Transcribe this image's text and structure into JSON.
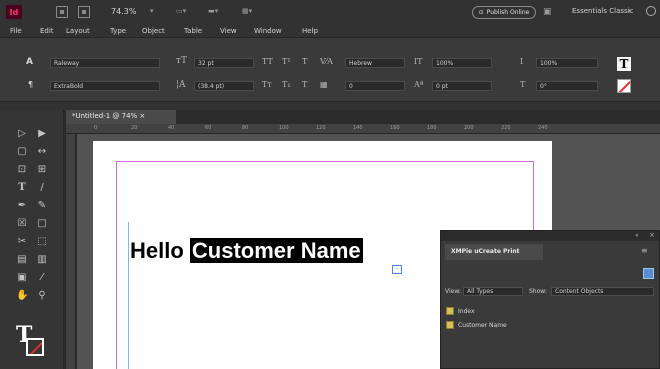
{
  "appbar": {
    "logo": "Id",
    "zoom": "74.3%",
    "publish_label": "Publish Online",
    "workspace": "Essentials Classic"
  },
  "menubar": {
    "items": [
      "File",
      "Edit",
      "Layout",
      "Type",
      "Object",
      "Table",
      "View",
      "Window",
      "Help"
    ]
  },
  "control": {
    "font_family": "Raleway",
    "font_style": "ExtraBold",
    "font_size": "32 pt",
    "leading": "(38.4 pt)",
    "lang": "Hebrew",
    "tracking": "0",
    "hscale": "100%",
    "vscale": "100%",
    "baseline": "0 pt",
    "skew": "0°"
  },
  "document": {
    "tab_label": "*Untitled-1 @ 74% ×",
    "ruler": [
      "0",
      "20",
      "40",
      "60",
      "80",
      "100",
      "120",
      "140",
      "160",
      "180",
      "200",
      "220",
      "240"
    ],
    "text_normal": "Hello",
    "text_selected": "Customer Name"
  },
  "panel": {
    "title": "XMPie uCreate Print",
    "view_label": "View:",
    "view_value": "All Types",
    "show_label": "Show:",
    "show_value": "Content Objects",
    "items": [
      "Index",
      "Customer Name"
    ]
  }
}
